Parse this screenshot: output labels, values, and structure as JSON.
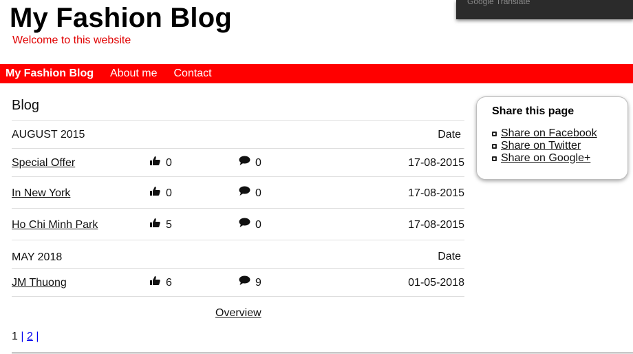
{
  "header": {
    "title": "My Fashion Blog",
    "tagline": "Welcome to this website"
  },
  "translate_bar": {
    "label": "Google Translate"
  },
  "nav": {
    "brand": "My Fashion Blog",
    "items": [
      {
        "label": "About me"
      },
      {
        "label": "Contact"
      }
    ]
  },
  "blog": {
    "heading": "Blog",
    "groups": [
      {
        "month": "AUGUST 2015",
        "date_header": "Date",
        "posts": [
          {
            "title": "Special Offer",
            "likes": "0",
            "comments": "0",
            "date": "17-08-2015"
          },
          {
            "title": "In New York",
            "likes": "0",
            "comments": "0",
            "date": "17-08-2015"
          },
          {
            "title": "Ho Chi Minh Park",
            "likes": "5",
            "comments": "0",
            "date": "17-08-2015"
          }
        ]
      },
      {
        "month": "MAY 2018",
        "date_header": "Date",
        "posts": [
          {
            "title": "JM Thuong",
            "likes": "6",
            "comments": "9",
            "date": "01-05-2018"
          }
        ]
      }
    ],
    "overview_label": "Overview",
    "pagination": {
      "current": "1",
      "separator": "|",
      "pages": [
        "2"
      ]
    }
  },
  "share": {
    "title": "Share this page",
    "items": [
      {
        "label": "Share on Facebook"
      },
      {
        "label": "Share on Twitter"
      },
      {
        "label": "Share on Google+"
      }
    ]
  },
  "colors": {
    "accent": "#ff0000",
    "tagline": "#e00000",
    "link": "#0000ee"
  },
  "icons": {
    "like": "thumbs-up-icon",
    "comment": "speech-bubble-icon"
  }
}
